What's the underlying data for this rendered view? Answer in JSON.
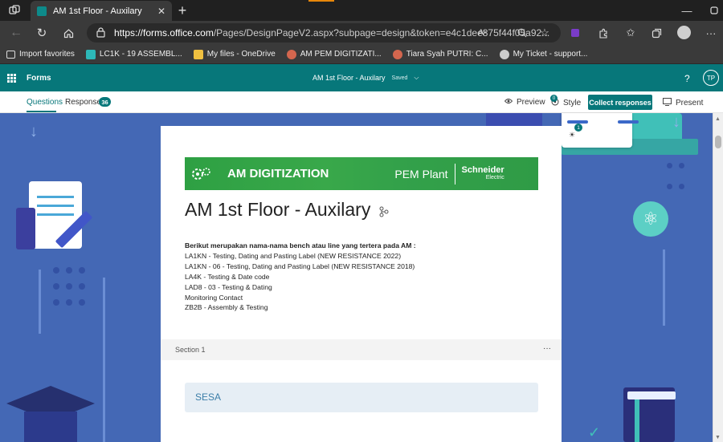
{
  "browser": {
    "tab_title": "AM 1st Floor - Auxilary",
    "url_host": "https://forms.office.com",
    "url_path": "/Pages/DesignPageV2.aspx?subpage=design&token=e4c1dee875f44f05a92...",
    "favorites": [
      {
        "label": "Import favorites",
        "icon": "import-icon",
        "color": "#dddddd"
      },
      {
        "label": "LC1K - 19 ASSEMBL...",
        "icon": "tableau-icon",
        "color": "#2db8b8"
      },
      {
        "label": "My files - OneDrive",
        "icon": "folder-icon",
        "color": "#f0c040"
      },
      {
        "label": "AM PEM DIGITIZATI...",
        "icon": "app-icon",
        "color": "#d4664e"
      },
      {
        "label": "Tiara Syah PUTRI: C...",
        "icon": "app-icon",
        "color": "#d4664e"
      },
      {
        "label": "My Ticket - support...",
        "icon": "support-icon",
        "color": "#cccccc"
      }
    ]
  },
  "forms_bar": {
    "app_name": "Forms",
    "doc_title": "AM 1st Floor - Auxilary",
    "save_status": "Saved",
    "help": "?",
    "avatar": "TP"
  },
  "command_bar": {
    "questions_tab": "Questions",
    "responses_tab": "Responses",
    "responses_count": "36",
    "preview": "Preview",
    "style": "Style",
    "style_badge": "0",
    "collect": "Collect responses",
    "present": "Present",
    "side_badge": "1"
  },
  "form": {
    "banner_left": "AM DIGITIZATION",
    "banner_mid": "PEM Plant",
    "banner_brand_1": "Schneider",
    "banner_brand_2": "Electric",
    "title": "AM 1st Floor - Auxilary",
    "desc_intro": "Berikut merupakan nama-nama bench atau line yang tertera pada AM :",
    "desc_lines": [
      "LA1KN - Testing, Dating and Pasting Label (NEW RESISTANCE 2022)",
      "LA1KN - 06 - Testing, Dating and Pasting Label (NEW RESISTANCE 2018)",
      "LA4K - Testing & Date code",
      "LAD8 - 03 - Testing & Dating",
      "Monitoring Contact",
      "ZB2B - Assembly & Testing"
    ],
    "section_label": "Section 1",
    "section_more": "···",
    "question_title": "SESA"
  },
  "colors": {
    "forms_teal": "#07777a",
    "bg_blue": "#4468b5",
    "banner_green": "#33a14a",
    "collect_btn": "#07777a"
  }
}
